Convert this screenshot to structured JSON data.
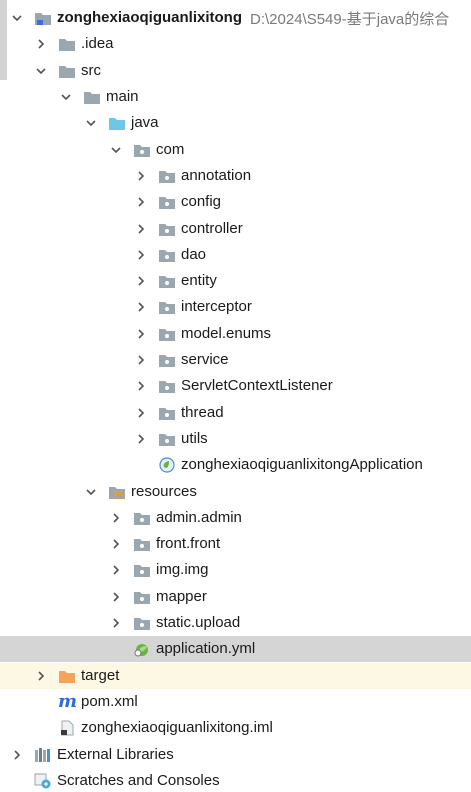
{
  "project": {
    "name": "zonghexiaoqiguanlixitong",
    "path": "D:\\2024\\S549-基于java的综合"
  },
  "tree": {
    "idea": ".idea",
    "src": "src",
    "main": "main",
    "java": "java",
    "com": "com",
    "packages": {
      "annotation": "annotation",
      "config": "config",
      "controller": "controller",
      "dao": "dao",
      "entity": "entity",
      "interceptor": "interceptor",
      "model_enums": "model.enums",
      "service": "service",
      "servlet_context_listener": "ServletContextListener",
      "thread": "thread",
      "utils": "utils"
    },
    "application_class": "zonghexiaoqiguanlixitongApplication",
    "resources": "resources",
    "resource_folders": {
      "admin": "admin.admin",
      "front": "front.front",
      "img": "img.img",
      "mapper": "mapper",
      "static_upload": "static.upload"
    },
    "application_yml": "application.yml",
    "target": "target",
    "pom": "pom.xml",
    "iml": "zonghexiaoqiguanlixitong.iml",
    "external_libraries": "External Libraries",
    "scratches": "Scratches and Consoles"
  },
  "colors": {
    "selected_row": "#d5d5d5",
    "excluded_row": "#fdf8e4",
    "folder_gray": "#9aa7b0",
    "source_folder_blue": "#6ec6e8",
    "target_folder_orange": "#f5a25d",
    "spring_green": "#6cb33e"
  }
}
